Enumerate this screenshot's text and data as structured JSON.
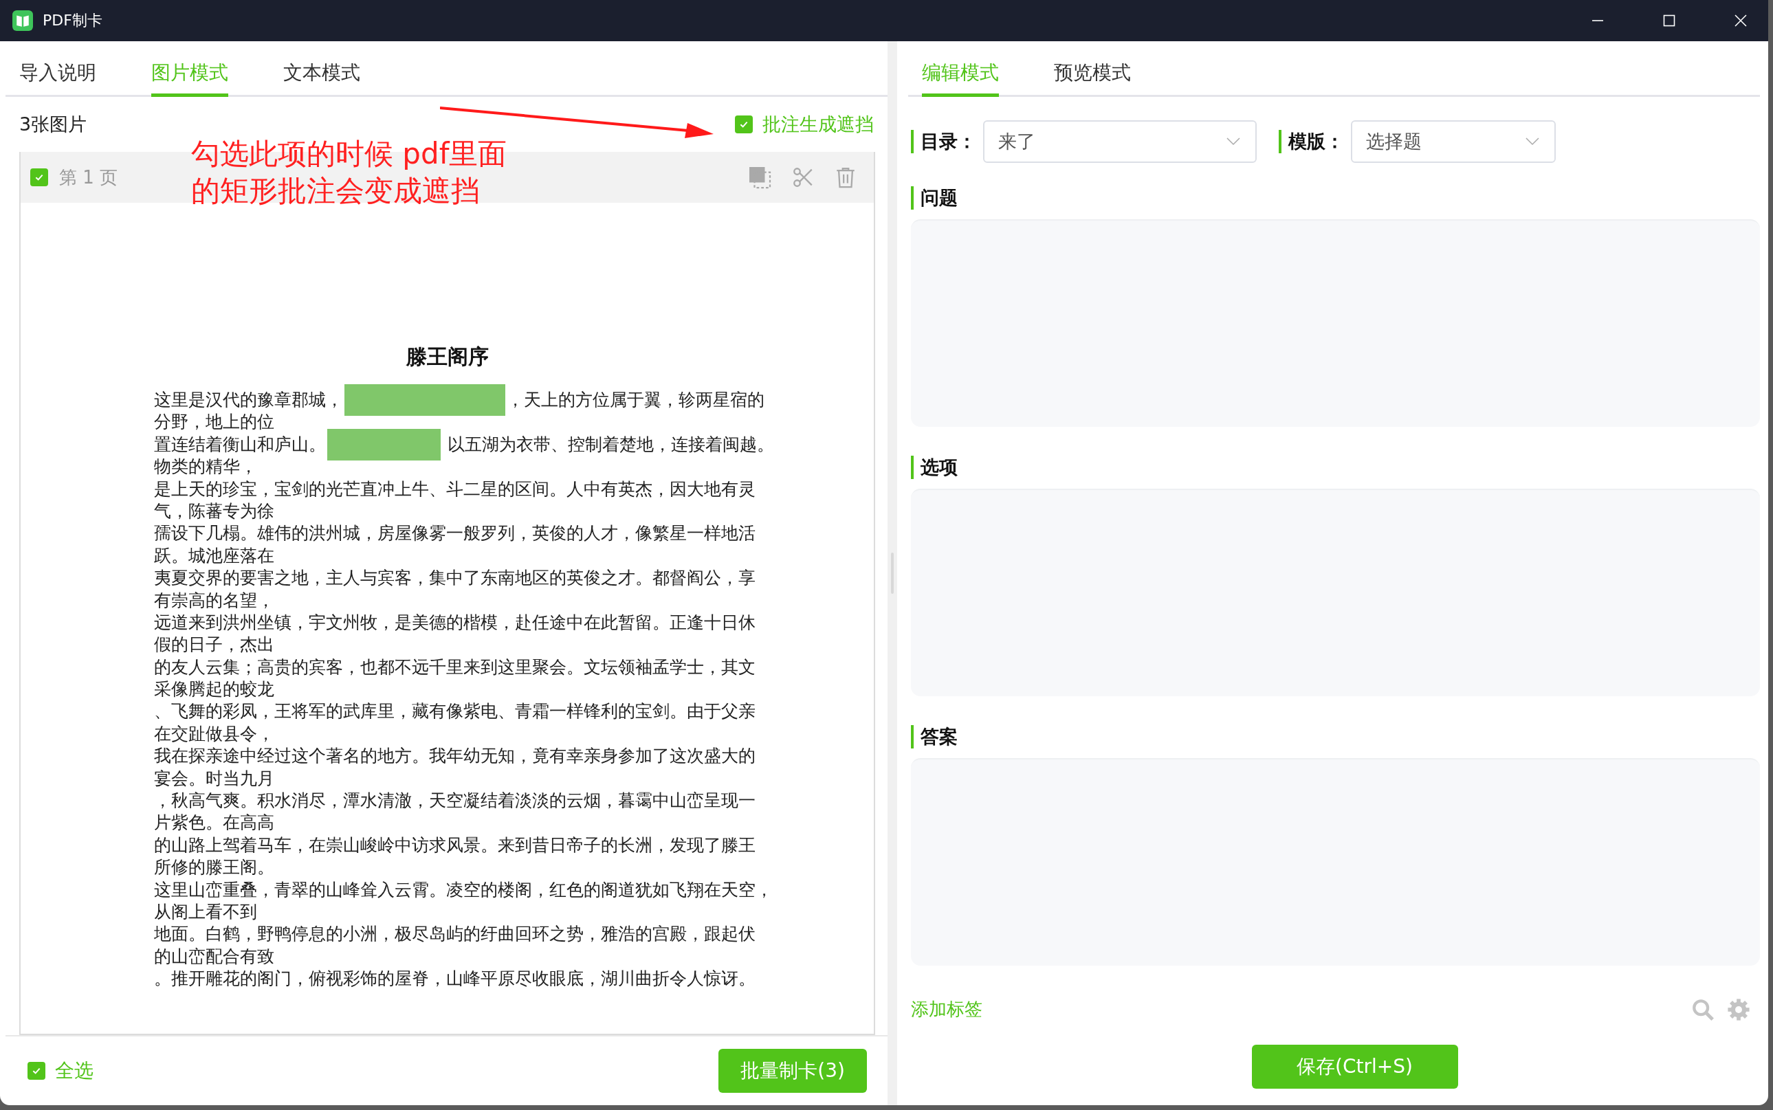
{
  "window": {
    "title": "PDF制卡"
  },
  "left_tabs": [
    {
      "label": "导入说明",
      "selected": false
    },
    {
      "label": "图片模式",
      "selected": true
    },
    {
      "label": "文本模式",
      "selected": false
    }
  ],
  "image_count": "3张图片",
  "mask_option": {
    "label": "批注生成遮挡",
    "checked": true
  },
  "annotation": {
    "lines": [
      "勾选此项的时候 pdf里面",
      "的矩形批注会变成遮挡"
    ]
  },
  "page": {
    "label": "第 1 页",
    "checked": true,
    "title": "滕王阁序",
    "lines": [
      [
        {
          "kind": "text",
          "text": "这里是汉代的豫章郡城，"
        },
        {
          "kind": "mask_wide"
        },
        {
          "kind": "text",
          "text": "，天上的方位属于翼，轸两星宿的"
        }
      ],
      [
        {
          "kind": "text",
          "text": "分野，地上的位"
        }
      ],
      [
        {
          "kind": "text",
          "text": "置连结着衡山和庐山。"
        },
        {
          "kind": "mask_narrow"
        },
        {
          "kind": "text",
          "text": "以五湖为衣带、控制着楚地，连接着闽越。"
        }
      ],
      [
        {
          "kind": "text",
          "text": "物类的精华，"
        }
      ],
      [
        {
          "kind": "text",
          "text": "是上天的珍宝，宝剑的光芒直冲上牛、斗二星的区间。人中有英杰，因大地有灵"
        }
      ],
      [
        {
          "kind": "text",
          "text": "气，陈蕃专为徐"
        }
      ],
      [
        {
          "kind": "text",
          "text": "孺设下几榻。雄伟的洪州城，房屋像雾一般罗列，英俊的人才，像繁星一样地活"
        }
      ],
      [
        {
          "kind": "text",
          "text": "跃。城池座落在"
        }
      ],
      [
        {
          "kind": "text",
          "text": "夷夏交界的要害之地，主人与宾客，集中了东南地区的英俊之才。都督阎公，享"
        }
      ],
      [
        {
          "kind": "text",
          "text": "有崇高的名望，"
        }
      ],
      [
        {
          "kind": "text",
          "text": "远道来到洪州坐镇，宇文州牧，是美德的楷模，赴任途中在此暂留。正逢十日休"
        }
      ],
      [
        {
          "kind": "text",
          "text": "假的日子，杰出"
        }
      ],
      [
        {
          "kind": "text",
          "text": "的友人云集；高贵的宾客，也都不远千里来到这里聚会。文坛领袖孟学士，其文"
        }
      ],
      [
        {
          "kind": "text",
          "text": "采像腾起的蛟龙"
        }
      ],
      [
        {
          "kind": "text",
          "text": "、飞舞的彩凤，王将军的武库里，藏有像紫电、青霜一样锋利的宝剑。由于父亲"
        }
      ],
      [
        {
          "kind": "text",
          "text": "在交趾做县令，"
        }
      ],
      [
        {
          "kind": "text",
          "text": "我在探亲途中经过这个著名的地方。我年幼无知，竟有幸亲身参加了这次盛大的"
        }
      ],
      [
        {
          "kind": "text",
          "text": "宴会。时当九月"
        }
      ],
      [
        {
          "kind": "text",
          "text": "，秋高气爽。积水消尽，潭水清澈，天空凝结着淡淡的云烟，暮霭中山峦呈现一"
        }
      ],
      [
        {
          "kind": "text",
          "text": "片紫色。在高高"
        }
      ],
      [
        {
          "kind": "text",
          "text": "的山路上驾着马车，在崇山峻岭中访求风景。来到昔日帝子的长洲，发现了滕王"
        }
      ],
      [
        {
          "kind": "text",
          "text": "所修的滕王阁。"
        }
      ],
      [
        {
          "kind": "text",
          "text": "这里山峦重叠，青翠的山峰耸入云霄。凌空的楼阁，红色的阁道犹如飞翔在天空，"
        }
      ],
      [
        {
          "kind": "text",
          "text": "从阁上看不到"
        }
      ],
      [
        {
          "kind": "text",
          "text": "地面。白鹤，野鸭停息的小洲，极尽岛屿的纡曲回环之势，雅浩的宫殿，跟起伏"
        }
      ],
      [
        {
          "kind": "text",
          "text": "的山峦配合有致"
        }
      ],
      [
        {
          "kind": "text",
          "text": "。推开雕花的阁门，俯视彩饰的屋脊，山峰平原尽收眼底，湖川曲折令人惊讶。"
        }
      ]
    ]
  },
  "select_all": {
    "label": "全选",
    "checked": true
  },
  "batch_button": "批量制卡(3)",
  "right_tabs": [
    {
      "label": "编辑模式",
      "selected": true
    },
    {
      "label": "预览模式",
      "selected": false
    }
  ],
  "directory": {
    "label": "目录：",
    "value": "来了"
  },
  "template": {
    "label": "模版：",
    "value": "选择题"
  },
  "sections": [
    {
      "title": "问题"
    },
    {
      "title": "选项"
    },
    {
      "title": "答案"
    }
  ],
  "add_tag": "添加标签",
  "save_button": "保存(Ctrl+S)"
}
